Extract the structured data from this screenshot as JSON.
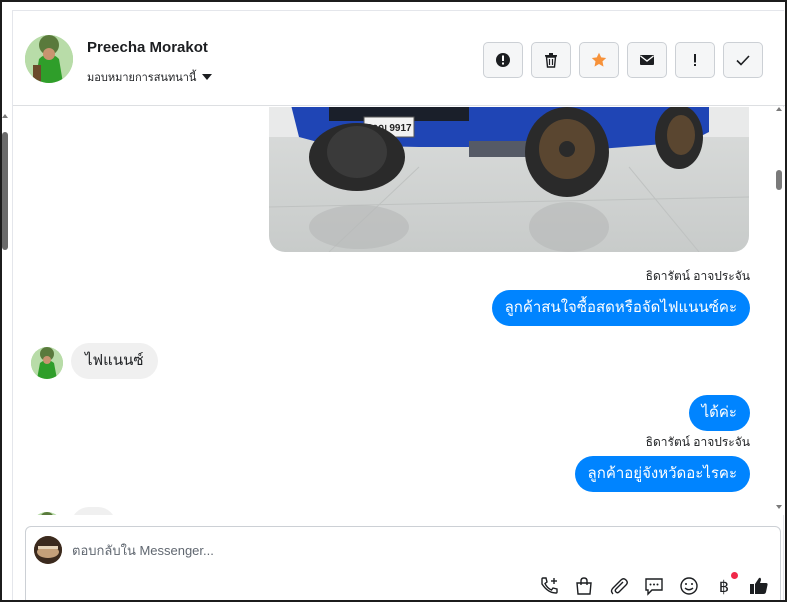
{
  "header": {
    "name": "Preecha Morakot",
    "assign_label": "มอบหมายการสนทนานี้",
    "actions": [
      {
        "icon": "alert-circle-icon"
      },
      {
        "icon": "trash-icon"
      },
      {
        "icon": "star-icon"
      },
      {
        "icon": "envelope-icon"
      },
      {
        "icon": "exclamation-icon"
      },
      {
        "icon": "checkmark-icon"
      }
    ]
  },
  "thread": {
    "photo": {
      "plate_text": "8กฌ 9917"
    },
    "sender_1": "ธิดารัตน์ อาจประจัน",
    "msg_out_1": "ลูกค้าสนใจซื้อสดหรือจัดไฟแนนซ์คะ",
    "msg_in_1": "ไฟแนนซ์",
    "msg_out_2": "ได้ค่ะ",
    "sender_2": "ธิดารัตน์ อาจประจัน",
    "msg_out_3": "ลูกค้าอยู่จังหวัดอะไรคะ",
    "msg_in_2": "...."
  },
  "composer": {
    "placeholder": "ตอบกลับใน Messenger...",
    "tools": [
      "phone-plus-icon",
      "shopping-bag-icon",
      "paperclip-icon",
      "chat-bubble-icon",
      "smiley-icon",
      "baht-icon",
      "thumbs-up-icon"
    ]
  },
  "colors": {
    "accent": "#0084ff",
    "star": "#f7923a",
    "badge_dot": "#f02849"
  }
}
